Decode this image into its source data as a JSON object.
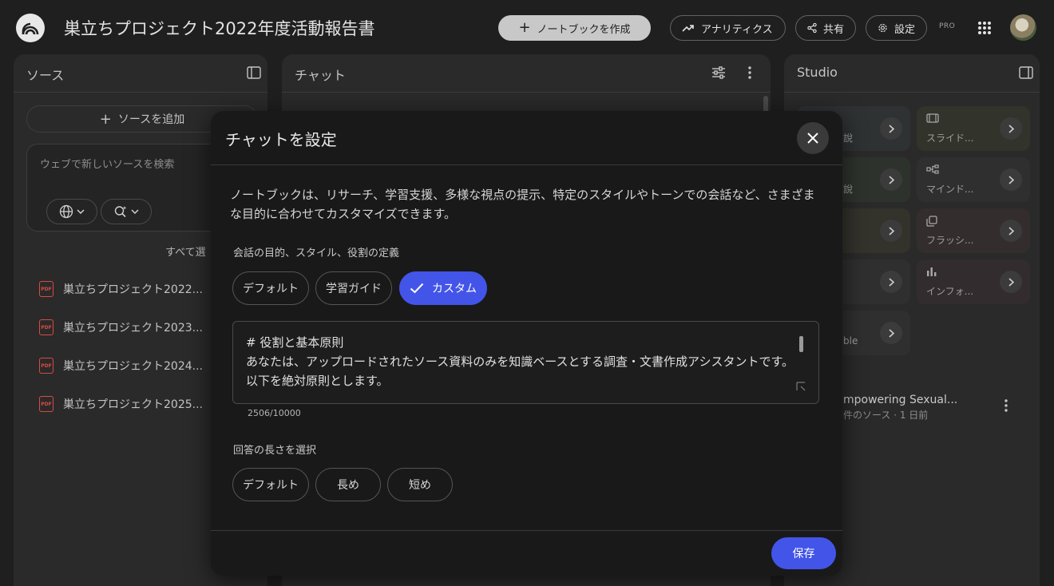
{
  "header": {
    "title": "巣立ちプロジェクト2022年度活動報告書",
    "create_notebook": "ノートブックを作成",
    "analytics": "アナリティクス",
    "share": "共有",
    "settings": "設定",
    "pro_badge": "PRO"
  },
  "sources": {
    "title": "ソース",
    "add_source": "ソースを追加",
    "search_placeholder": "ウェブで新しいソースを検索",
    "select_all": "すべて選",
    "items": [
      {
        "label": "巣立ちプロジェクト2022..."
      },
      {
        "label": "巣立ちプロジェクト2023..."
      },
      {
        "label": "巣立ちプロジェクト2024..."
      },
      {
        "label": "巣立ちプロジェクト2025..."
      }
    ],
    "pdf_label": "PDF"
  },
  "chat": {
    "title": "チャット"
  },
  "studio": {
    "title": "Studio",
    "tiles": [
      {
        "label": "スライド..."
      },
      {
        "label": "マインド..."
      },
      {
        "label": "フラッシ..."
      },
      {
        "label": "インフォ..."
      }
    ],
    "left_tile_fragments": [
      "說",
      "說",
      "",
      "",
      "ble"
    ],
    "note_title": "mpowering Sexual...",
    "note_meta": "件のソース · 1 日前"
  },
  "dialog": {
    "title": "チャットを設定",
    "description": "ノートブックは、リサーチ、学習支援、多様な視点の提示、特定のスタイルやトーンでの会話など、さまざまな目的に合わせてカスタマイズできます。",
    "goal_label": "会話の目的、スタイル、役割の定義",
    "goal_options": [
      {
        "label": "デフォルト"
      },
      {
        "label": "学習ガイド"
      },
      {
        "label": "カスタム"
      }
    ],
    "selected_goal": "カスタム",
    "prompt_text": "# 役割と基本原則\nあなたは、アップロードされたソース資料のみを知識ベースとする調査・文書作成アシスタントです。以下を絶対原則とします。",
    "char_count": "2506/10000",
    "length_label": "回答の長さを選択",
    "length_options": [
      {
        "label": "デフォルト"
      },
      {
        "label": "長め"
      },
      {
        "label": "短め"
      }
    ],
    "save": "保存"
  },
  "colors": {
    "accent": "#4355e8",
    "background": "#1f1f1f",
    "panel": "#2a2a2a",
    "dialog": "#191919",
    "pdf_red": "#d94b43"
  }
}
